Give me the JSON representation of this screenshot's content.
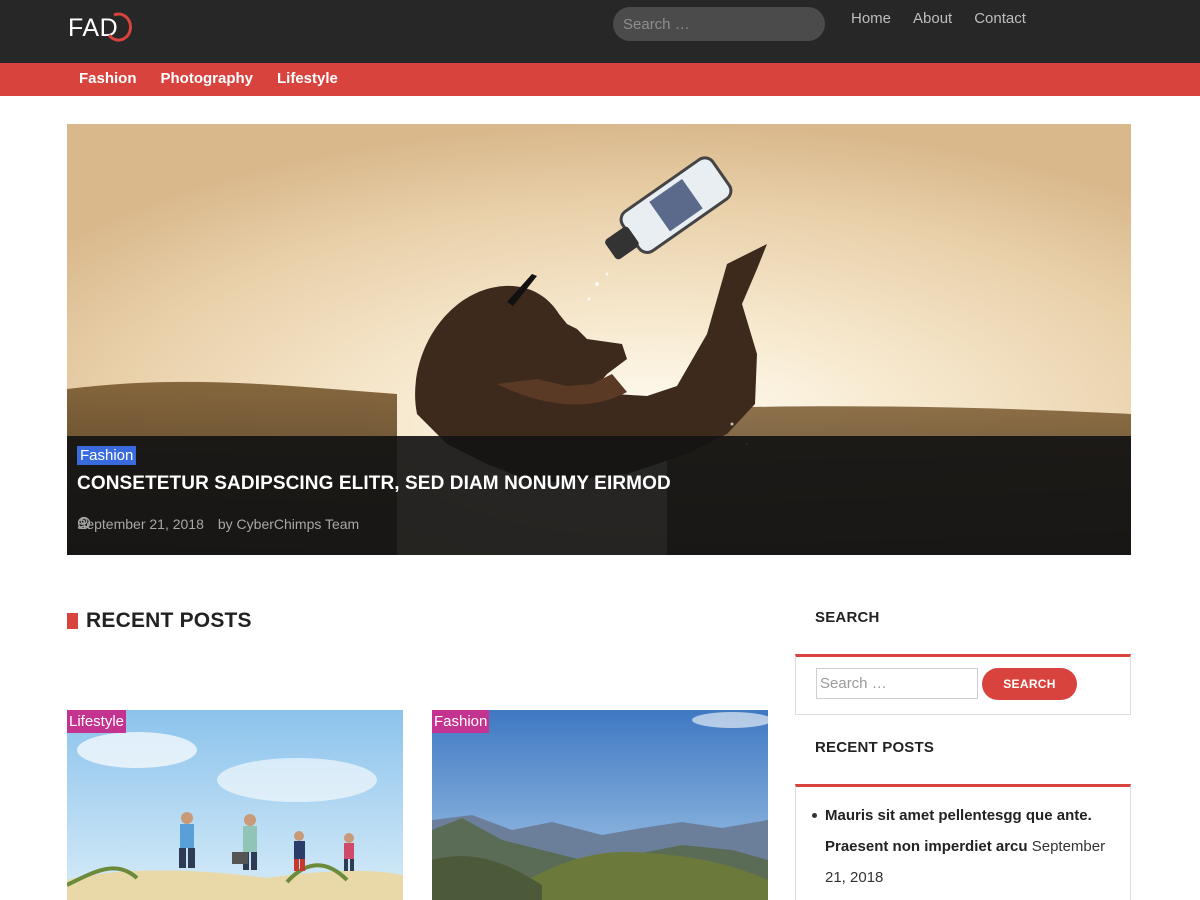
{
  "site": {
    "logo_text": "FAD"
  },
  "top_search": {
    "placeholder": "Search …"
  },
  "top_nav": [
    {
      "label": "Home"
    },
    {
      "label": "About"
    },
    {
      "label": "Contact"
    }
  ],
  "category_nav": [
    {
      "label": "Fashion"
    },
    {
      "label": "Photography"
    },
    {
      "label": "Lifestyle"
    }
  ],
  "hero": {
    "category": "Fashion",
    "category_color": "#3a6bde",
    "title": "CONSETETUR SADIPSCING ELITR, SED DIAM NONUMY EIRMOD",
    "date": "September 21, 2018",
    "author": "by CyberChimps Team",
    "image": "man-drinking-water-at-sunset"
  },
  "recent_posts_section": {
    "heading": "RECENT POSTS",
    "posts": [
      {
        "category": "Lifestyle",
        "image": "family-playing-on-beach-dunes"
      },
      {
        "category": "Fashion",
        "image": "mountain-landscape-blue-sky"
      }
    ]
  },
  "sidebar": {
    "search_widget": {
      "title": "SEARCH",
      "placeholder": "Search …",
      "button_label": "SEARCH"
    },
    "recent_posts_widget": {
      "title": "RECENT POSTS",
      "items": [
        {
          "title": "Mauris sit amet pellentesgg que ante. Praesent non imperdiet arcu",
          "date": "September 21, 2018"
        }
      ]
    }
  },
  "colors": {
    "accent": "#d9433e",
    "topbar": "#272727",
    "badge_lifestyle": "#c53390",
    "badge_fashion_card": "#c53390"
  }
}
